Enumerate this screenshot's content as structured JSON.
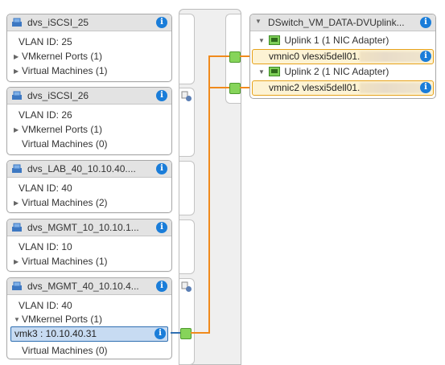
{
  "portgroups": [
    {
      "title": "dvs_iSCSI_25",
      "vlan": "VLAN ID: 25",
      "vmkernel": "VMkernel Ports (1)",
      "vms": "Virtual Machines (1)"
    },
    {
      "title": "dvs_iSCSI_26",
      "vlan": "VLAN ID: 26",
      "vmkernel": "VMkernel Ports (1)",
      "vms": "Virtual Machines (0)"
    },
    {
      "title": "dvs_LAB_40_10.10.40....",
      "vlan": "VLAN ID: 40",
      "vms": "Virtual Machines (2)"
    },
    {
      "title": "dvs_MGMT_10_10.10.1...",
      "vlan": "VLAN ID: 10",
      "vms": "Virtual Machines (1)"
    },
    {
      "title": "dvs_MGMT_40_10.10.4...",
      "vlan": "VLAN ID: 40",
      "vmkernel": "VMkernel Ports (1)",
      "vmk": "vmk3 : 10.10.40.31",
      "vms": "Virtual Machines (0)"
    }
  ],
  "switch": {
    "title": "DSwitch_VM_DATA-DVUplink...",
    "uplinks": [
      {
        "label": "Uplink 1 (1 NIC Adapter)",
        "nic": "vmnic0 vlesxi5dell01."
      },
      {
        "label": "Uplink 2 (1 NIC Adapter)",
        "nic": "vmnic2 vlesxi5dell01."
      }
    ]
  },
  "colors": {
    "accent": "#1a7dd9",
    "wire": "#f08a1c",
    "connector": "#86d45a",
    "selected": "#c7dbf2",
    "uplink_highlight": "#fdf3d4"
  },
  "icons": {
    "portgroup": "network-icon",
    "info": "info-icon",
    "expand": "triangle-icon",
    "uplink": "nic-icon"
  }
}
